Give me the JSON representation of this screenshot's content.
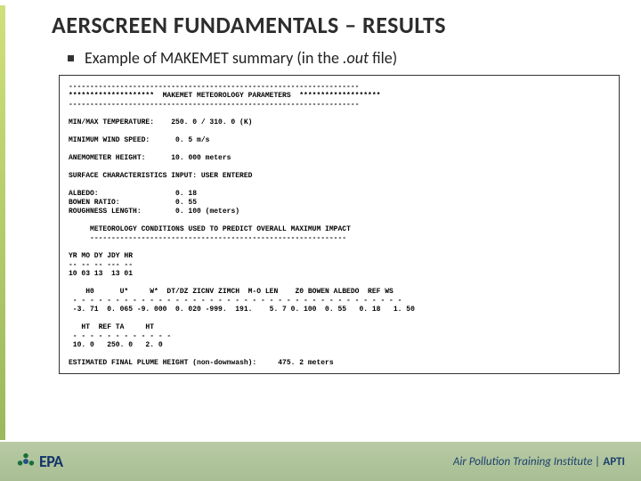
{
  "slide": {
    "title": "AERSCREEN FUNDAMENTALS – RESULTS",
    "bullet_pre": "Example of MAKEMET summary (in the ",
    "bullet_em": ".out",
    "bullet_post": " file)"
  },
  "makemet": {
    "hr1": "--------------------------------------------------------------------",
    "hr2": "********************  MAKEMET METEOROLOGY PARAMETERS  *******************",
    "hr3": "--------------------------------------------------------------------",
    "minmax_label": "MIN/MAX TEMPERATURE:",
    "minmax_value": "250. 0 / 310. 0 (K)",
    "minwind_label": "MINIMUM WIND SPEED:",
    "minwind_value": "0. 5 m/s",
    "anemo_label": "ANEMOMETER HEIGHT:",
    "anemo_value": "10. 000 meters",
    "surf_hdr": "SURFACE CHARACTERISTICS INPUT: USER ENTERED",
    "albedo_label": "ALBEDO:",
    "albedo_value": "0. 18",
    "bowen_label": "BOWEN RATIO:",
    "bowen_value": "0. 55",
    "rough_label": "ROUGHNESS LENGTH:",
    "rough_value": "0. 100 (meters)",
    "metcond": "METEOROLOGY CONDITIONS USED TO PREDICT OVERALL MAXIMUM IMPACT",
    "metline": "------------------------------------------------------------",
    "datehdr": "YR MO DY JDY HR",
    "datesep": "-- -- -- --- --",
    "dateval": "10 03 13  13 01",
    "methdr": "    H0      U*     W*  DT/DZ ZICNV ZIMCH  M-O LEN    Z0 BOWEN ALBEDO  REF WS",
    "metsep": " - - - - - - - - - - - - - - - - - - - - - - - - - - - - - - - - - - - - - - -",
    "metval": " -3. 71  0. 065 -9. 000  0. 020 -999.  191.    5. 7 0. 100  0. 55   0. 18   1. 50",
    "hthdr": "   HT  REF TA     HT",
    "htsep": " - - - - - - - - - - - -",
    "htval": " 10. 0   250. 0   2. 0",
    "plume_label": "ESTIMATED FINAL PLUME HEIGHT (non-downwash):",
    "plume_value": "475. 2 meters"
  },
  "footer": {
    "epa": "EPA",
    "apti_pre": "Air Pollution Training Institute | ",
    "apti_b": "APTI"
  }
}
